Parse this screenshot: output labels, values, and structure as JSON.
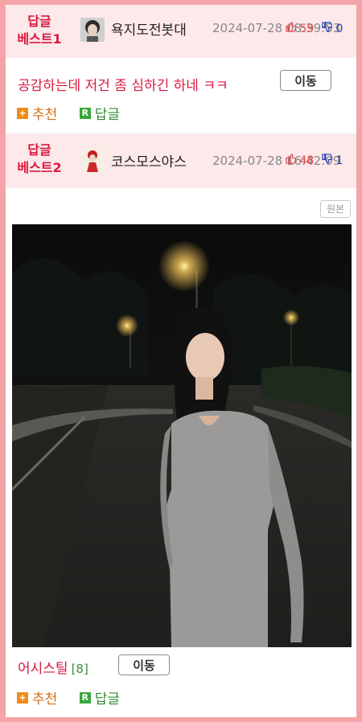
{
  "replies": [
    {
      "best_line1": "답글",
      "best_line2": "베스트1",
      "nickname": "욕지도전봇대",
      "date": "2024-07-28 08:39:53",
      "up": "59",
      "down": "0",
      "comment": "공감하는데 저건 좀 심하긴 하네 ㅋㅋ",
      "move_label": "이동",
      "recommend_label": "추천",
      "reply_label": "답글"
    },
    {
      "best_line1": "답글",
      "best_line2": "베스트2",
      "nickname": "코스모스야스",
      "date": "2024-07-28 16:42:09",
      "up": "48",
      "down": "1",
      "original_label": "원본",
      "title": "어시스틸",
      "count": "[8]",
      "move_label": "이동",
      "recommend_label": "추천",
      "reply_label": "답글"
    }
  ],
  "icons": {
    "thumb_up": "thumb-up-icon",
    "thumb_down": "thumb-down-icon",
    "plus": "plus-square-icon",
    "reply": "reply-r-icon"
  },
  "colors": {
    "frame": "#f4a4a8",
    "header_bg": "#fde8ea",
    "best_text": "#d8193f",
    "up": "#e24a4a",
    "down": "#1a3fb7"
  }
}
